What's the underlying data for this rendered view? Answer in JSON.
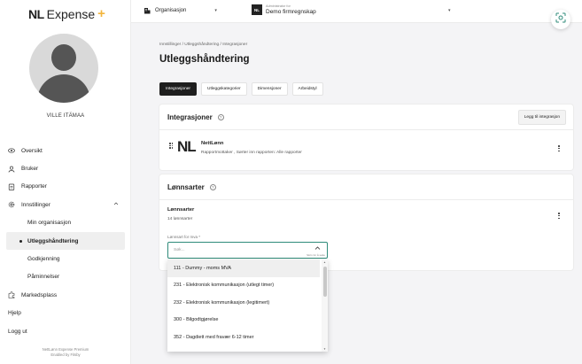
{
  "brand": {
    "mark": "NL",
    "word": "Expense",
    "plus": "+"
  },
  "user": {
    "name": "VILLE ITÄMAA"
  },
  "nav": {
    "overview": "Oversikt",
    "users": "Bruker",
    "reports": "Rapporter",
    "settings": "Innstillinger",
    "my_org": "Min organisasjon",
    "expense_handling": "Utleggshåndtering",
    "approval": "Godkjenning",
    "reminders": "Påminnelser",
    "marketplace": "Markedsplass",
    "help": "Hjelp",
    "logout": "Logg ut"
  },
  "footer": {
    "line1": "NettLønn Expense Premium",
    "line2": "Enabled by Fitsby"
  },
  "topbar": {
    "org_label": "Organisasjon",
    "company_caption": "Administrator for",
    "company_name": "Demo firmregnskap",
    "company_badge": "NL"
  },
  "breadcrumb": "Innstillinger / Utleggshåndtering / Integrasjoner",
  "page_title": "Utleggshåndtering",
  "tabs": [
    "Integrasjoner",
    "Utleggskategorier",
    "Dimensjoner",
    "Arbeidstyl"
  ],
  "integrations": {
    "title": "Integrasjoner",
    "add_button": "Legg til integrasjon",
    "item": {
      "logo": "NL",
      "name": "NettLønn",
      "description": "Rapportmottaker , Sørter inn rapporten: Alle rapporter"
    }
  },
  "salary_types": {
    "title": "Lønnsarter",
    "subtitle": "Lønnsarter",
    "count": "14 lønnsarter",
    "field_label": "Lønnsart for mva *",
    "placeholder": "Søk...",
    "hint": "Skriv for å søke",
    "options": [
      "111 - Dummy - moms MVA",
      "231 - Elektronisk kommunikasjon (utlegt timer)",
      "232 - Elektronisk kommunikasjon (legitimert)",
      "300 - Bilgodtgjørelse",
      "352 - Dagdiett med fravær 6-12 timer"
    ]
  }
}
